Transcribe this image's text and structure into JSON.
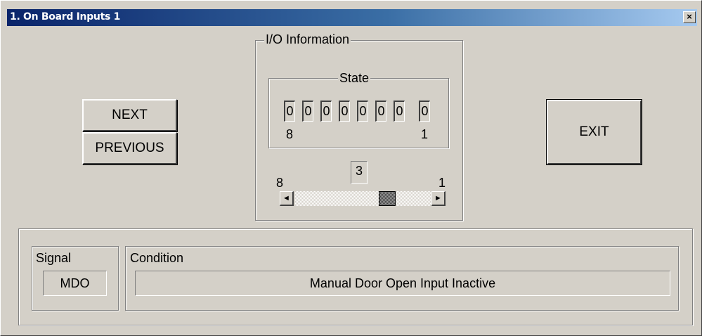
{
  "window": {
    "title": "1. On Board Inputs 1",
    "close_label": "×"
  },
  "nav": {
    "next_label": "NEXT",
    "previous_label": "PREVIOUS",
    "exit_label": "EXIT"
  },
  "io_info": {
    "title": "I/O Information",
    "state": {
      "title": "State",
      "bits": [
        "0",
        "0",
        "0",
        "0",
        "0",
        "0",
        "0",
        "0"
      ],
      "left_index_label": "8",
      "right_index_label": "1"
    },
    "selector": {
      "value": "3",
      "left_label": "8",
      "right_label": "1",
      "left_arrow": "◄",
      "right_arrow": "►"
    }
  },
  "signal": {
    "label": "Signal",
    "value": "MDO"
  },
  "condition": {
    "label": "Condition",
    "value": "Manual Door Open Input Inactive"
  },
  "colors": {
    "face": "#d4d0c8",
    "title_start": "#0a246a",
    "title_end": "#a6caf0"
  }
}
